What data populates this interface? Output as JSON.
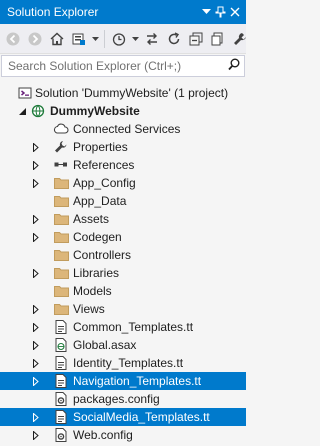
{
  "window": {
    "title": "Solution Explorer"
  },
  "search": {
    "placeholder": "Search Solution Explorer (Ctrl+;)"
  },
  "colors": {
    "accent": "#007acc",
    "folder": "#dcb67a",
    "background": "#f5f5f5"
  },
  "tree": {
    "solution": {
      "label": "Solution 'DummyWebsite' (1 project)",
      "icon": "solution-icon"
    },
    "project": {
      "label": "DummyWebsite",
      "icon": "web-project-icon"
    },
    "items": [
      {
        "label": "Connected Services",
        "icon": "connected-services-icon",
        "expander": false,
        "selected": false
      },
      {
        "label": "Properties",
        "icon": "wrench-icon",
        "expander": true,
        "selected": false
      },
      {
        "label": "References",
        "icon": "references-icon",
        "expander": true,
        "selected": false
      },
      {
        "label": "App_Config",
        "icon": "folder-icon",
        "expander": true,
        "selected": false
      },
      {
        "label": "App_Data",
        "icon": "folder-icon",
        "expander": false,
        "selected": false
      },
      {
        "label": "Assets",
        "icon": "folder-icon",
        "expander": true,
        "selected": false
      },
      {
        "label": "Codegen",
        "icon": "folder-icon",
        "expander": true,
        "selected": false
      },
      {
        "label": "Controllers",
        "icon": "folder-icon",
        "expander": false,
        "selected": false
      },
      {
        "label": "Libraries",
        "icon": "folder-icon",
        "expander": true,
        "selected": false
      },
      {
        "label": "Models",
        "icon": "folder-icon",
        "expander": false,
        "selected": false
      },
      {
        "label": "Views",
        "icon": "folder-icon",
        "expander": true,
        "selected": false
      },
      {
        "label": "Common_Templates.tt",
        "icon": "tt-file-icon",
        "expander": true,
        "selected": false
      },
      {
        "label": "Global.asax",
        "icon": "asax-file-icon",
        "expander": true,
        "selected": false
      },
      {
        "label": "Identity_Templates.tt",
        "icon": "tt-file-icon",
        "expander": true,
        "selected": false
      },
      {
        "label": "Navigation_Templates.tt",
        "icon": "tt-file-icon",
        "expander": true,
        "selected": true
      },
      {
        "label": "packages.config",
        "icon": "config-file-icon",
        "expander": false,
        "selected": false
      },
      {
        "label": "SocialMedia_Templates.tt",
        "icon": "tt-file-icon",
        "expander": true,
        "selected": true
      },
      {
        "label": "Web.config",
        "icon": "config-file-icon",
        "expander": true,
        "selected": false
      }
    ]
  }
}
